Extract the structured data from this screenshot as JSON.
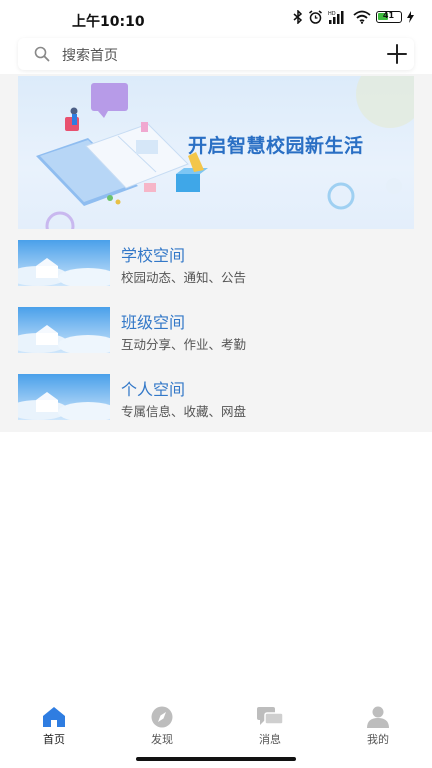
{
  "status_bar": {
    "time": "上午10:10",
    "battery": "41",
    "icons": [
      "bluetooth-icon",
      "alarm-icon",
      "hd-signal-icon",
      "wifi-icon",
      "battery-icon",
      "charging-icon"
    ]
  },
  "search": {
    "placeholder": "搜索首页",
    "icon": "search-icon",
    "action_icon": "add-icon"
  },
  "banner": {
    "title": "开启智慧校园新生活"
  },
  "spaces": [
    {
      "title": "学校空间",
      "subtitle": "校园动态、通知、公告"
    },
    {
      "title": "班级空间",
      "subtitle": "互动分享、作业、考勤"
    },
    {
      "title": "个人空间",
      "subtitle": "专属信息、收藏、网盘"
    }
  ],
  "tabbar": {
    "active_color": "#2f7de1",
    "inactive_color": "#bdbdbd",
    "tabs": [
      {
        "label": "首页",
        "icon": "home-icon",
        "active": true
      },
      {
        "label": "发现",
        "icon": "compass-icon",
        "active": false
      },
      {
        "label": "消息",
        "icon": "chat-icon",
        "active": false
      },
      {
        "label": "我的",
        "icon": "user-icon",
        "active": false
      }
    ]
  }
}
